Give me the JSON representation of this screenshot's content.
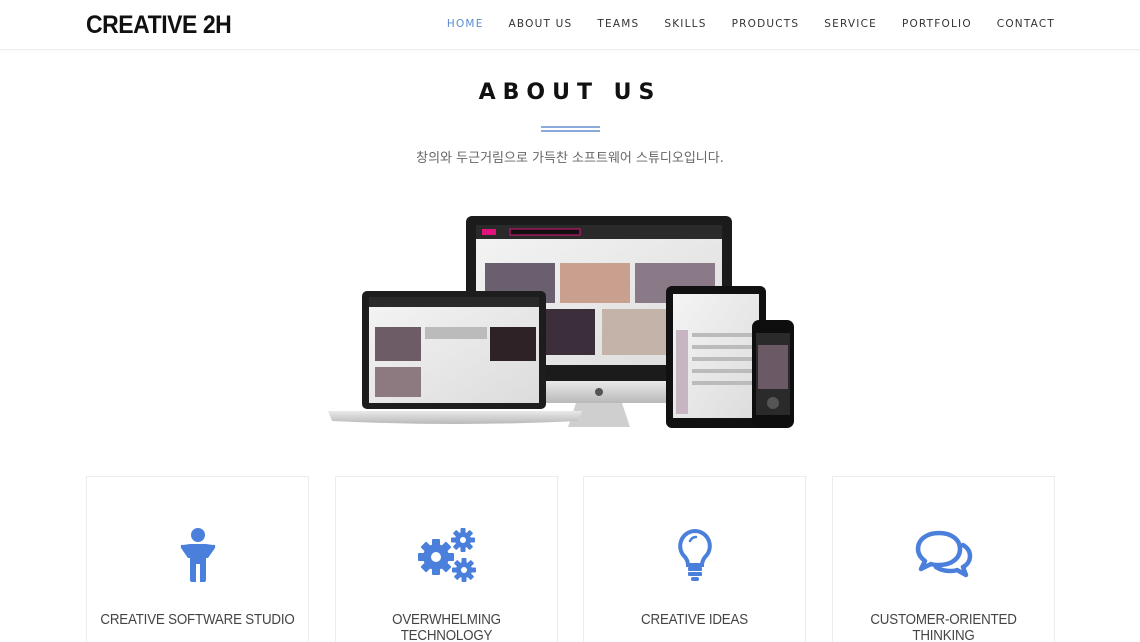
{
  "header": {
    "logo": "CREATIVE 2H",
    "nav": [
      {
        "label": "HOME",
        "active": true
      },
      {
        "label": "ABOUT US"
      },
      {
        "label": "TEAMS"
      },
      {
        "label": "SKILLS"
      },
      {
        "label": "PRODUCTS"
      },
      {
        "label": "SERVICE"
      },
      {
        "label": "PORTFOLIO"
      },
      {
        "label": "CONTACT"
      }
    ]
  },
  "about": {
    "title": "ABOUT US",
    "subtitle": "창의와 두근거림으로 가득찬 소프트웨어 스튜디오입니다.",
    "features": [
      {
        "icon": "person-icon",
        "label": "CREATIVE SOFTWARE STUDIO"
      },
      {
        "icon": "gears-icon",
        "label": "OVERWHELMING TECHNOLOGY"
      },
      {
        "icon": "lightbulb-icon",
        "label": "CREATIVE IDEAS"
      },
      {
        "icon": "chat-bubbles-icon",
        "label": "CUSTOMER-ORIENTED THINKING"
      }
    ]
  },
  "colors": {
    "accent": "#5b8bd6",
    "icon": "#4a7fdc",
    "divider": "#8aa9dc"
  }
}
